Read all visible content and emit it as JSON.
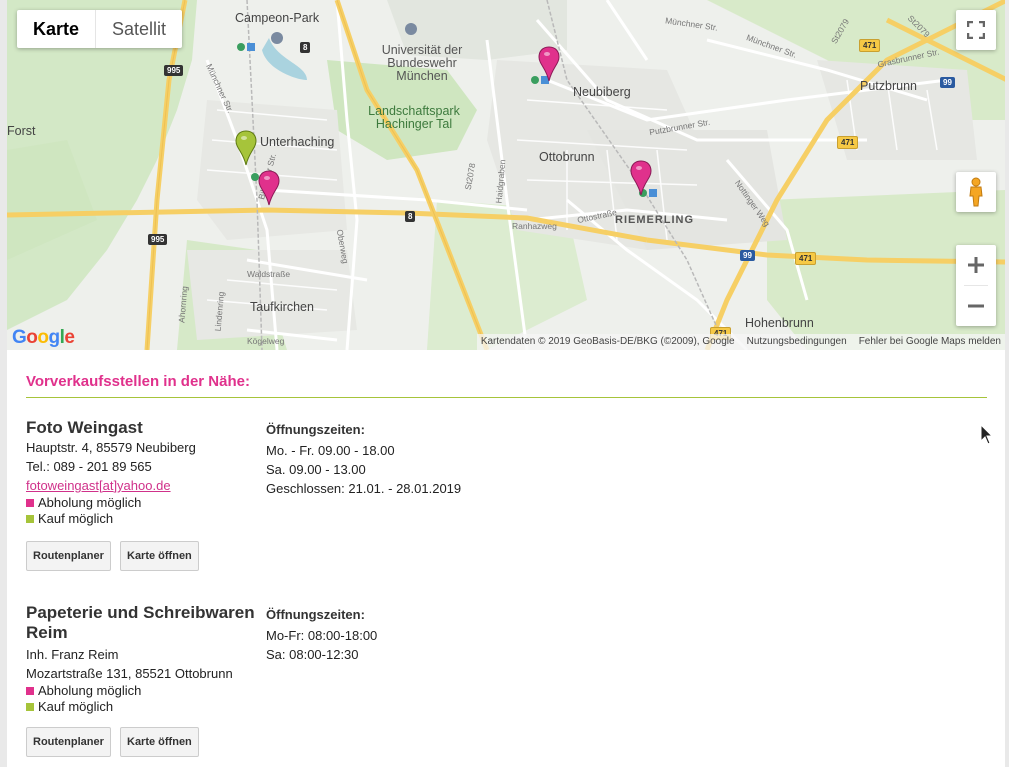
{
  "map": {
    "type_controls": [
      "Karte",
      "Satellit"
    ],
    "labels": {
      "campeon": "Campeon-Park",
      "university": "Universität der\nBundeswehr\nMünchen",
      "park": "Landschaftspark\nHachinger Tal",
      "unterhaching": "Unterhaching",
      "neubiberg": "Neubiberg",
      "putzbrunn": "Putzbrunn",
      "ottobrunn": "Ottobrunn",
      "riemerling": "RIEMERLING",
      "taufkirchen": "Taufkirchen",
      "hohenbrunn": "Hohenbrunn",
      "forst": "Forst",
      "muenchner_str_top": "Münchner Str.",
      "muenchner_str_right": "Münchner Str.",
      "muenchner_str_left": "Münchner Str.",
      "grasbrunner": "Grasbrunner Str.",
      "putzbrunner": "Putzbrunner Str.",
      "ranhazweg": "Ranhazweg",
      "ottostrasse": "Ottostraße",
      "waldstrasse": "Waldstraße",
      "biberger": "Biberger Str.",
      "haidgraben": "Haidgraben",
      "oberweg": "Oberweg",
      "koegelweg": "Kögelweg",
      "ahornring": "Ahornring",
      "lindenring": "Lindenring",
      "nottinger": "Nottinger Weg"
    },
    "shields": {
      "a995_top": "995",
      "a995_bottom": "995",
      "b8_top": "8",
      "b8_mid": "8",
      "b471_top": "471",
      "b471_mid": "471",
      "b471_right": "471",
      "b471_bottom": "471",
      "a99_top": "99",
      "a99_bottom": "99",
      "st2078": "St2078",
      "st2079": "St2079",
      "st2079b": "St2079"
    },
    "attribution": {
      "data": "Kartendaten © 2019 GeoBasis-DE/BKG (©2009), Google",
      "terms": "Nutzungsbedingungen",
      "report": "Fehler bei Google Maps melden"
    },
    "colors": {
      "pin_pink": "#e0318c",
      "pin_green": "#a6c43a"
    }
  },
  "content": {
    "section_title": "Vorverkaufsstellen in der Nähe:",
    "stores": [
      {
        "name": "Foto Weingast",
        "lines": [
          "Hauptstr. 4, 85579 Neubiberg",
          "Tel.: 089 - 201 89 565"
        ],
        "email": "fotoweingast[at]yahoo.de",
        "features": [
          "Abholung möglich",
          "Kauf möglich"
        ],
        "buttons": [
          "Routenplaner",
          "Karte öffnen"
        ],
        "hours_title": "Öffnungszeiten:",
        "hours": [
          "Mo. - Fr. 09.00 - 18.00",
          "Sa. 09.00 - 13.00",
          "Geschlossen: 21.01. - 28.01.2019"
        ]
      },
      {
        "name": "Papeterie und Schreibwaren Reim",
        "lines": [
          "Inh. Franz Reim",
          "Mozartstraße 131, 85521 Ottobrunn"
        ],
        "features": [
          "Abholung möglich",
          "Kauf möglich"
        ],
        "buttons": [
          "Routenplaner",
          "Karte öffnen"
        ],
        "hours_title": "Öffnungszeiten:",
        "hours": [
          "Mo-Fr: 08:00-18:00",
          "Sa: 08:00-12:30"
        ]
      }
    ]
  }
}
